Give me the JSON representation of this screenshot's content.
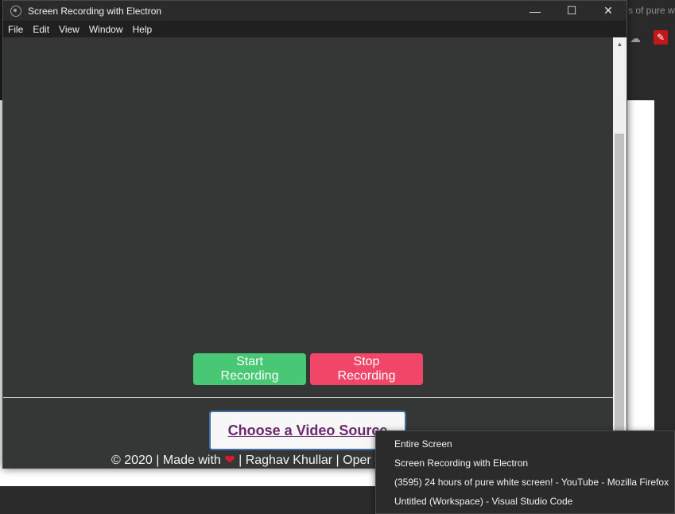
{
  "background": {
    "tab_text": "s of pure w"
  },
  "window": {
    "title": "Screen Recording with Electron",
    "controls": {
      "minimize": "—",
      "maximize": "☐",
      "close": "✕"
    }
  },
  "menu": [
    "File",
    "Edit",
    "View",
    "Window",
    "Help"
  ],
  "buttons": {
    "start": "Start Recording",
    "stop": "Stop Recording",
    "choose_source": "Choose a Video Source"
  },
  "footer": {
    "prefix": "© 2020 | Made with ",
    "heart": "❤",
    "suffix": " | Raghav Khullar | Oper"
  },
  "context_menu": [
    "Entire Screen",
    "Screen Recording with Electron",
    "(3595) 24 hours of pure white screen! - YouTube - Mozilla Firefox",
    "Untitled (Workspace) - Visual Studio Code"
  ],
  "colors": {
    "start": "#48c774",
    "stop": "#f14668",
    "source_text": "#6b2a70"
  }
}
